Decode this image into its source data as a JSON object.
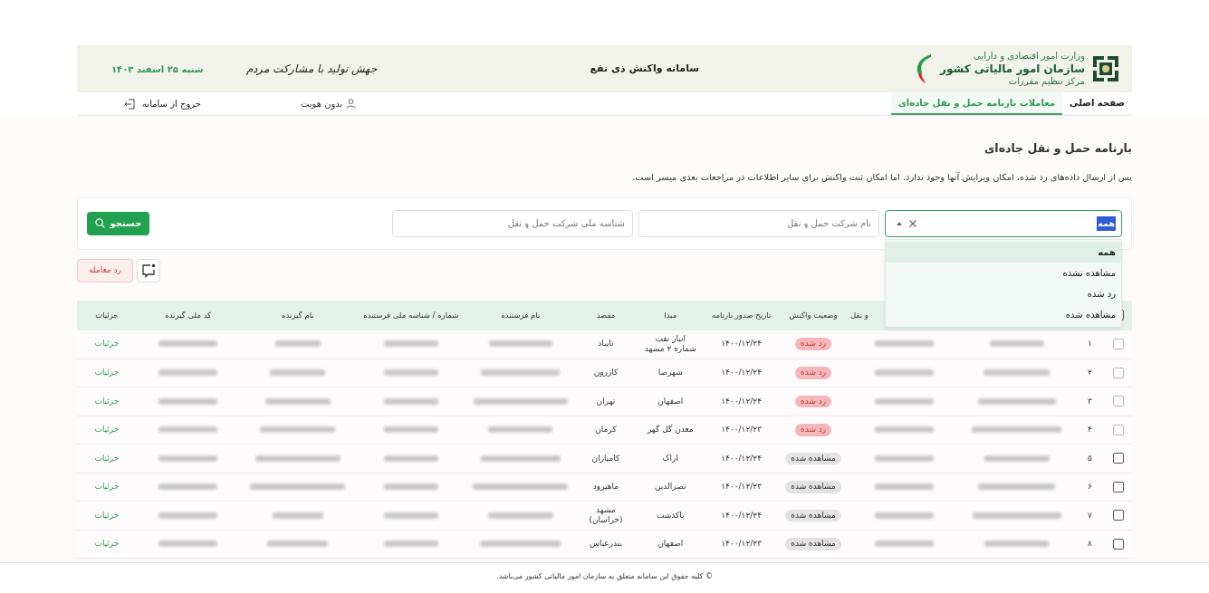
{
  "header": {
    "org_ministry": "وزارت امور اقتصادی و دارایی",
    "org_name": "سازمان امور مالیاتی کشور",
    "org_unit": "مرکز تنظیم مقررات",
    "system_title": "سامانه واکنش ذی نفع",
    "slogan": "جهش تولید با مشارکت مردم",
    "date": "شنبه ۲۵ اسفند ۱۴۰۳"
  },
  "nav": {
    "tabs": [
      {
        "label": "صفحه اصلی",
        "selected": false
      },
      {
        "label": "معاملات بارنامه حمل و نقل جاده‌ای",
        "selected": true
      }
    ],
    "user": "بدون هویت",
    "logout": "خروج از سامانه"
  },
  "page": {
    "title": "بارنامه حمل و نقل جاده‌ای",
    "note": "پس از ارسال داده‌های رد شده، امکان ویرایش آنها وجود ندارد. اما امکان ثبت واکنش برای سایر اطلاعات در مراجعات بعدی میسر است."
  },
  "filters": {
    "status_select": {
      "value": "همه",
      "expanded": true,
      "options": [
        {
          "label": "همه",
          "selected": true
        },
        {
          "label": "مشاهده نشده",
          "selected": false
        },
        {
          "label": "رد شده",
          "selected": false
        },
        {
          "label": "مشاهده شده",
          "selected": false
        }
      ]
    },
    "company_name": {
      "placeholder": "نام شرکت حمل و نقل"
    },
    "company_id": {
      "placeholder": "شناسه ملی شرکت حمل و نقل"
    },
    "search_button": "جستجو"
  },
  "actions": {
    "reject_button": "رد معامله"
  },
  "table": {
    "select_all_checked": false,
    "columns": [
      "",
      "",
      "",
      "و نقل",
      "وضعیت واکنش",
      "تاریخ صدور بارنامه",
      "مبدا",
      "مقصد",
      "نام فرستنده",
      "شماره / شناسه ملی فرستنده",
      "نام گیرنده",
      "کد ملی گیرنده",
      "جزئیات"
    ],
    "rows": [
      {
        "checked": false,
        "disabled": true,
        "index": "۱",
        "status": {
          "label": "رد شده",
          "kind": "rejected"
        },
        "date": "۱۴۰۰/۱۲/۲۴",
        "origin": "انبار نفت شماره ۲ مشهد",
        "destination": "تایباد",
        "details": "جزئیات"
      },
      {
        "checked": false,
        "disabled": true,
        "index": "۲",
        "status": {
          "label": "رد شده",
          "kind": "rejected"
        },
        "date": "۱۴۰۰/۱۲/۲۴",
        "origin": "شهرضا",
        "destination": "کازرون",
        "details": "جزئیات"
      },
      {
        "checked": false,
        "disabled": true,
        "index": "۳",
        "status": {
          "label": "رد شده",
          "kind": "rejected"
        },
        "date": "۱۴۰۰/۱۲/۲۴",
        "origin": "اصفهان",
        "destination": "تهران",
        "details": "جزئیات"
      },
      {
        "checked": false,
        "disabled": true,
        "index": "۴",
        "status": {
          "label": "رد شده",
          "kind": "rejected"
        },
        "date": "۱۴۰۰/۱۲/۲۳",
        "origin": "معدن گل گهر",
        "destination": "کرمان",
        "details": "جزئیات"
      },
      {
        "checked": false,
        "disabled": false,
        "index": "۵",
        "status": {
          "label": "مشاهده شده",
          "kind": "viewed"
        },
        "date": "۱۴۰۰/۱۲/۲۴",
        "origin": "اراک",
        "destination": "کامیاران",
        "details": "جزئیات"
      },
      {
        "checked": false,
        "disabled": false,
        "index": "۶",
        "status": {
          "label": "مشاهده شده",
          "kind": "viewed"
        },
        "date": "۱۴۰۰/۱۲/۲۳",
        "origin": "نصرالدین",
        "destination": "ماهیرود",
        "details": "جزئیات"
      },
      {
        "checked": false,
        "disabled": false,
        "index": "۷",
        "status": {
          "label": "مشاهده شده",
          "kind": "viewed"
        },
        "date": "۱۴۰۰/۱۲/۲۴",
        "origin": "پاکدشت",
        "destination": "مشهد (خراسان)",
        "details": "جزئیات"
      },
      {
        "checked": false,
        "disabled": false,
        "index": "۸",
        "status": {
          "label": "مشاهده شده",
          "kind": "viewed"
        },
        "date": "۱۴۰۰/۱۲/۲۳",
        "origin": "اصفهان",
        "destination": "بندرعباس",
        "details": "جزئیات"
      }
    ]
  },
  "footer": "© کلیه حقوق این سامانه متعلق به سازمان امور مالیاتی کشور می‌باشد."
}
